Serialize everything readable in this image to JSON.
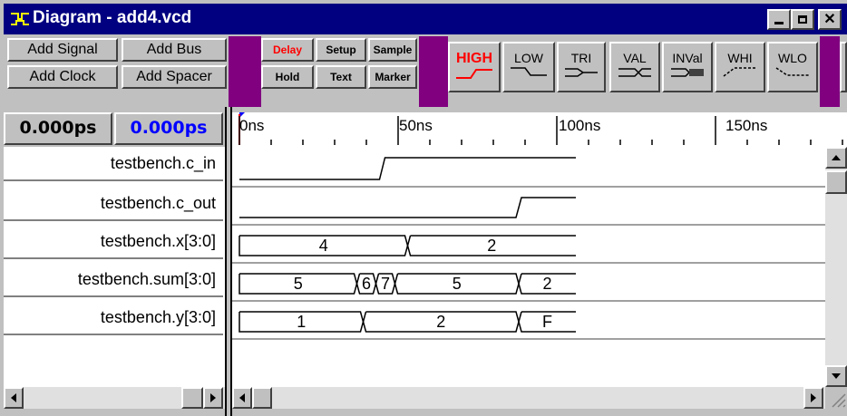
{
  "window": {
    "title": "Diagram - add4.vcd"
  },
  "toolbar": {
    "add_signal": "Add Signal",
    "add_bus": "Add Bus",
    "add_clock": "Add Clock",
    "add_spacer": "Add Spacer",
    "delay": "Delay",
    "setup": "Setup",
    "sample": "Sample",
    "hold": "Hold",
    "text": "Text",
    "marker": "Marker",
    "high": "HIGH",
    "low": "LOW",
    "tri": "TRI",
    "val": "VAL",
    "inval": "INVal",
    "whi": "WHI",
    "wlo": "WLO"
  },
  "time": {
    "cursor": "0.000ps",
    "marker": "0.000ps"
  },
  "ruler": {
    "labels": [
      "0ns",
      "50ns",
      "100ns",
      "150ns"
    ]
  },
  "signals": [
    {
      "name": "testbench.c_in"
    },
    {
      "name": "testbench.c_out"
    },
    {
      "name": "testbench.x[3:0]"
    },
    {
      "name": "testbench.sum[3:0]"
    },
    {
      "name": "testbench.y[3:0]"
    }
  ],
  "waves": {
    "c_in": {
      "type": "bit",
      "initial": 0,
      "edges": [
        45
      ]
    },
    "c_out": {
      "type": "bit",
      "initial": 0,
      "edges": [
        88
      ]
    },
    "x": {
      "type": "bus",
      "segments": [
        {
          "t0": 0,
          "t1": 53,
          "v": "4"
        },
        {
          "t0": 53,
          "t1": 106,
          "v": "2"
        }
      ]
    },
    "sum": {
      "type": "bus",
      "segments": [
        {
          "t0": 0,
          "t1": 37,
          "v": "5"
        },
        {
          "t0": 37,
          "t1": 43,
          "v": "6"
        },
        {
          "t0": 43,
          "t1": 49,
          "v": "7"
        },
        {
          "t0": 49,
          "t1": 88,
          "v": "5"
        },
        {
          "t0": 88,
          "t1": 106,
          "v": "2"
        }
      ]
    },
    "y": {
      "type": "bus",
      "segments": [
        {
          "t0": 0,
          "t1": 39,
          "v": "1"
        },
        {
          "t0": 39,
          "t1": 88,
          "v": "2"
        },
        {
          "t0": 88,
          "t1": 106,
          "v": "F"
        }
      ]
    }
  },
  "colors": {
    "title_bg": "#000080",
    "accent_purple": "#800080",
    "red": "#ff0000",
    "blue": "#0000ff"
  }
}
